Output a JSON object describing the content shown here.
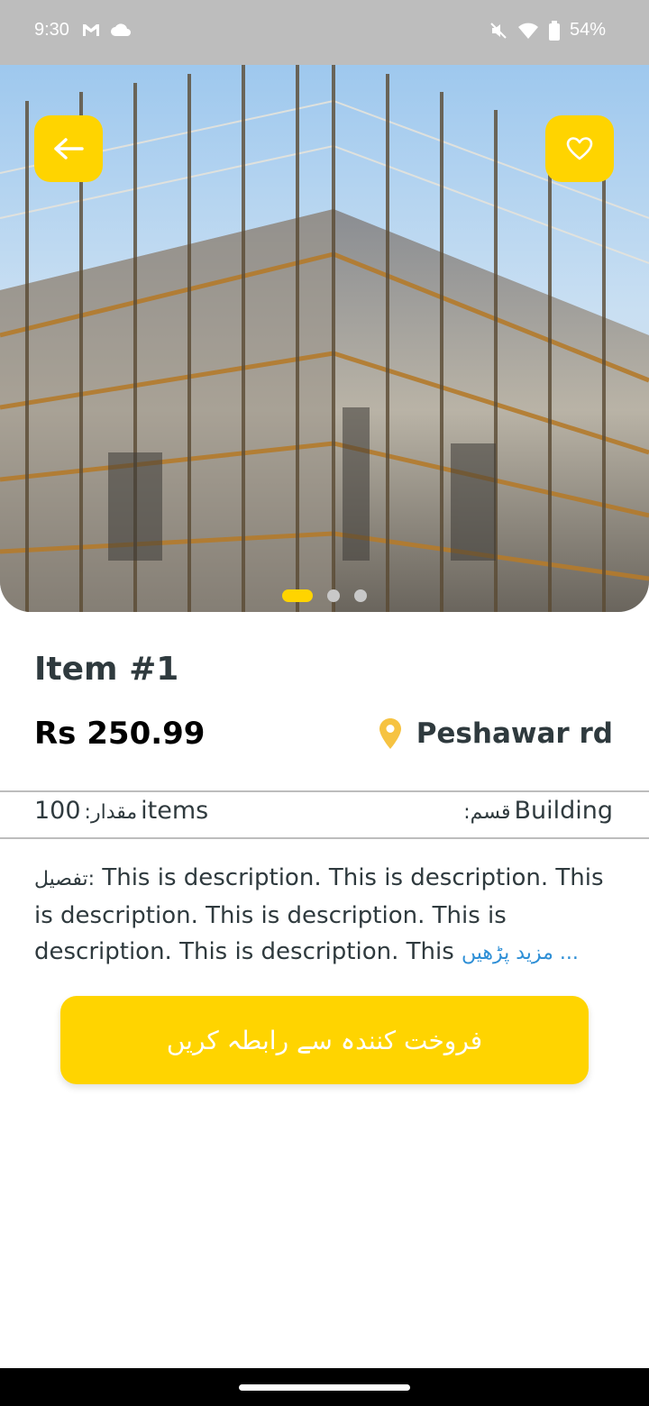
{
  "status_bar": {
    "time": "9:30",
    "battery": "54%",
    "icons": [
      "gmail-icon",
      "cloud-icon",
      "mute-icon",
      "wifi-icon",
      "battery-icon"
    ]
  },
  "hero": {
    "image": "scaffolding-building-photo",
    "back_icon": "arrow-left-icon",
    "favorite_icon": "heart-outline-icon",
    "slide_count": 3,
    "active_slide": 1
  },
  "item": {
    "title": "Item #1",
    "price": "Rs 250.99",
    "location": "Peshawar rd",
    "location_icon": "map-pin-icon",
    "quantity_label": "مقدار:",
    "quantity_value": "100",
    "quantity_unit": "items",
    "category_label": "قسم:",
    "category_value": "Building",
    "description_label": "تفصيل:",
    "description": " This is description. This is description. This is description. This is description. This is description. This is description. This",
    "read_more": "... مزید پڑھیں"
  },
  "actions": {
    "contact_seller": "فروخت کنندہ سے رابطہ کریں"
  },
  "colors": {
    "accent": "#ffd400",
    "pin": "#f6c342",
    "link": "#2e8fd6",
    "text": "#2f3a3e"
  }
}
